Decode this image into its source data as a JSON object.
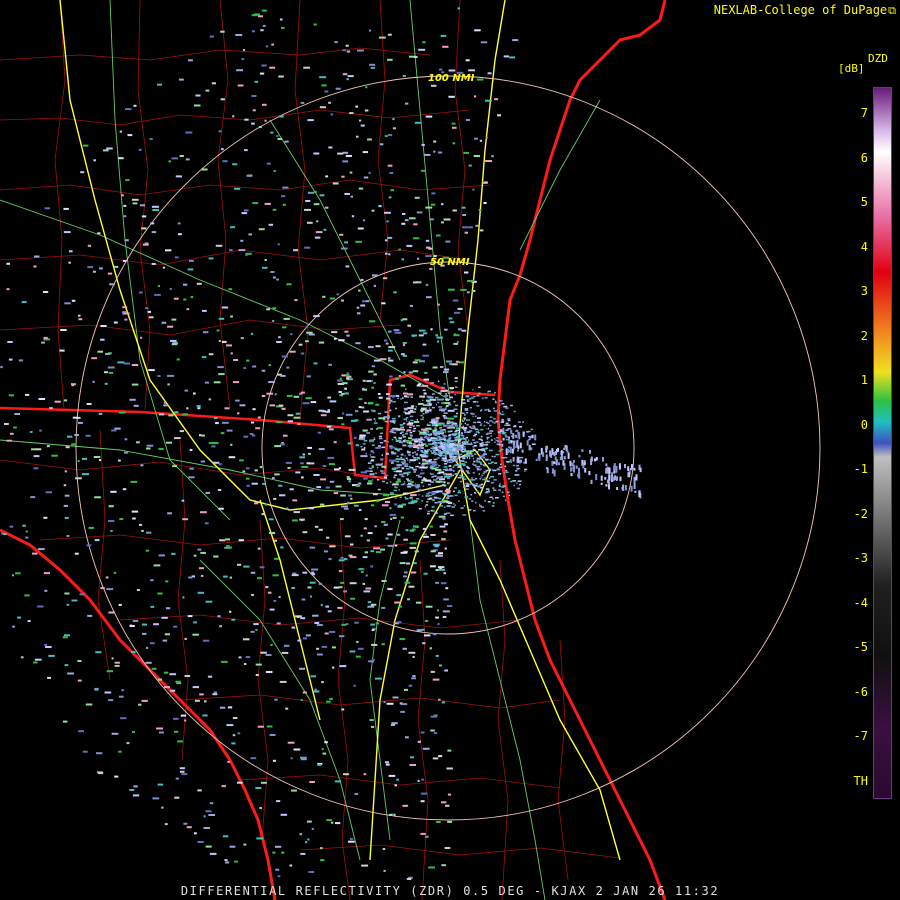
{
  "credit": {
    "text": "NEXLAB-College of DuPage",
    "icon": "external-link-icon"
  },
  "footer": {
    "text": "DIFFERENTIAL REFLECTIVITY (ZDR) 0.5 DEG - KJAX 2 JAN 26 11:32"
  },
  "legend": {
    "product": "DZD",
    "units": "[dB]",
    "ticks": [
      "7",
      "6",
      "5",
      "4",
      "3",
      "2",
      "1",
      "0",
      "-1",
      "-2",
      "-3",
      "-4",
      "-5",
      "-6",
      "-7",
      "TH"
    ],
    "colors": {
      "top": "#6a1a7a",
      "lavender": "#d8b8e8",
      "white": "#ffffff",
      "pink": "#e870a8",
      "red": "#e00010",
      "orange": "#f08020",
      "yellow": "#f0e020",
      "green": "#30c040",
      "cyan": "#20c0c0",
      "blue": "#4050c0",
      "gray": "#c0c0c0",
      "dark": "#202020",
      "purple": "#3a1040"
    }
  },
  "map": {
    "range_rings": [
      {
        "label": "100 NMI"
      },
      {
        "label": "50 NMI"
      }
    ],
    "colors": {
      "coast": "#ff1a1a",
      "state_border": "#ff1a1a",
      "county": "#a01010",
      "interstate": "#ffff33",
      "highway": "#66cc66",
      "ring": "#f4c8b8"
    }
  }
}
